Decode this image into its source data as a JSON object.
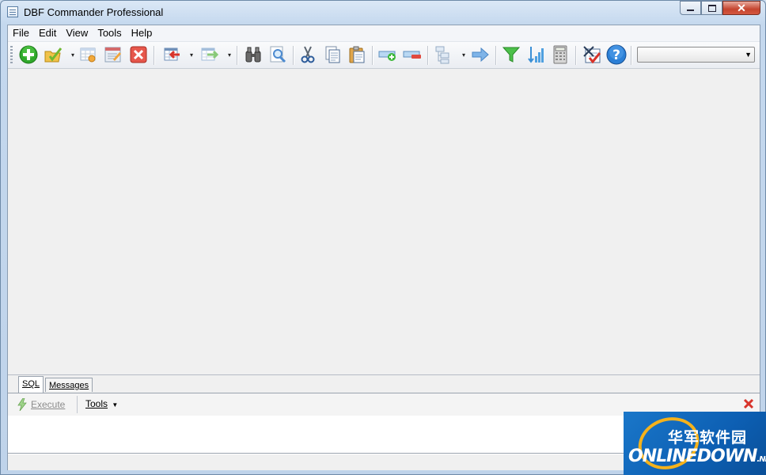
{
  "window": {
    "title": "DBF Commander Professional",
    "minimize_glyph": "▭",
    "maximize_glyph": "□",
    "close_glyph": "✕"
  },
  "menu": [
    "File",
    "Edit",
    "View",
    "Tools",
    "Help"
  ],
  "toolbar": {
    "buttons": [
      {
        "name": "new-table",
        "icon": "green-plus-icon"
      },
      {
        "name": "open-folder",
        "icon": "folder-check-icon"
      },
      {
        "name": "table-settings",
        "icon": "table-gear-icon"
      },
      {
        "name": "save-edit",
        "icon": "save-edit-icon"
      },
      {
        "name": "close-table",
        "icon": "red-x-icon"
      },
      {
        "name": "import",
        "icon": "import-icon"
      },
      {
        "name": "export",
        "icon": "export-icon"
      },
      {
        "name": "find",
        "icon": "binoculars-icon"
      },
      {
        "name": "find-page",
        "icon": "magnifier-page-icon"
      },
      {
        "name": "cut",
        "icon": "scissors-icon"
      },
      {
        "name": "copy",
        "icon": "copy-icon"
      },
      {
        "name": "paste",
        "icon": "paste-icon"
      },
      {
        "name": "add-record",
        "icon": "add-row-icon"
      },
      {
        "name": "delete-record",
        "icon": "remove-row-icon"
      },
      {
        "name": "structure",
        "icon": "tree-structure-icon"
      },
      {
        "name": "go-to",
        "icon": "right-arrow-icon"
      },
      {
        "name": "filter",
        "icon": "filter-icon"
      },
      {
        "name": "sort",
        "icon": "sort-icon"
      },
      {
        "name": "calculator",
        "icon": "calculator-icon"
      },
      {
        "name": "checklist",
        "icon": "checklist-icon"
      },
      {
        "name": "help",
        "icon": "help-icon"
      }
    ],
    "dropdown_arrow": "▾",
    "combo_value": "",
    "combo_arrow": "▼"
  },
  "bottom_panel": {
    "tabs": [
      "SQL",
      "Messages"
    ],
    "active_tab": "SQL",
    "execute_label": "Execute",
    "tools_label": "Tools",
    "tools_arrow": "▼"
  },
  "watermark": {
    "chinese": "华军软件园",
    "brand": "ONLINEDOWN",
    "suffix": ".NET"
  },
  "colors": {
    "accent_green": "#2fa82b",
    "accent_red": "#d8342b",
    "watermark_blue": "#1a77c9",
    "watermark_orange": "#f5b21b"
  }
}
